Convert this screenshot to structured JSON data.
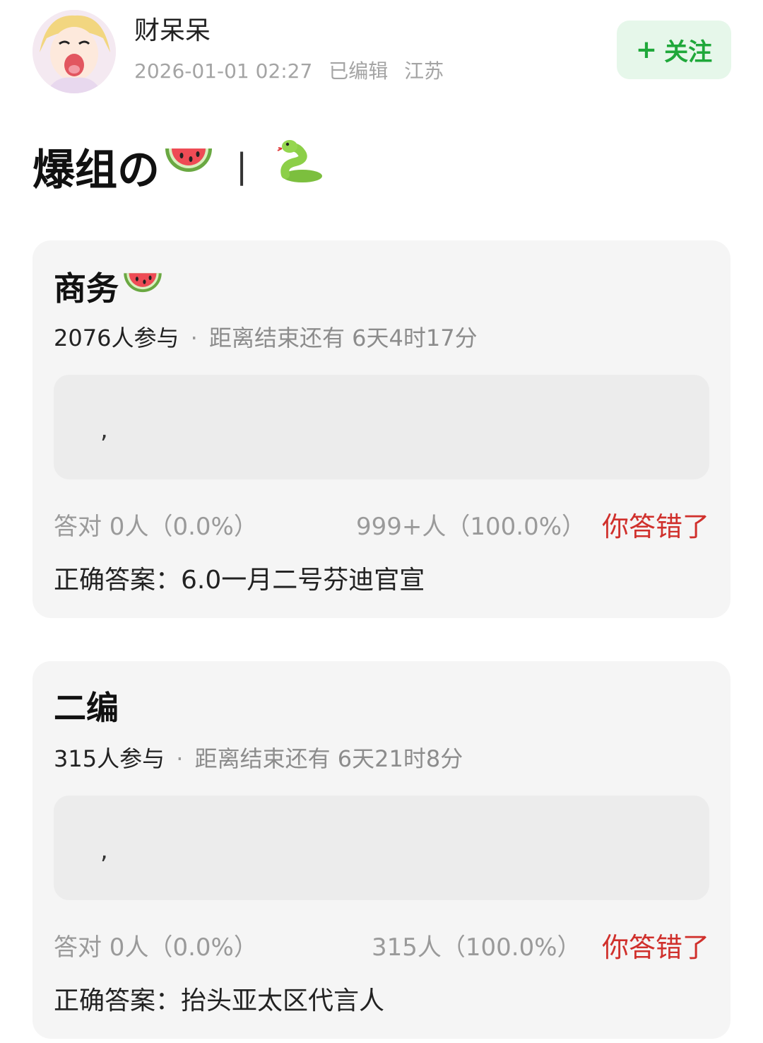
{
  "user": {
    "name": "财呆呆",
    "timestamp": "2026-01-01 02:27",
    "edited": "已编辑",
    "location": "江苏"
  },
  "follow_button": {
    "plus": "+",
    "label": "关注"
  },
  "post": {
    "title": "爆组の",
    "separator": "|"
  },
  "icons": {
    "watermelon": "watermelon-icon",
    "snake": "snake-icon"
  },
  "polls": [
    {
      "title": "商务",
      "participants": "2076人参与",
      "dot": "·",
      "remaining": "距离结束还有 6天4时17分",
      "option_text": ",",
      "correct_label": "答对  0人（0.0%）",
      "others": "999+人（100.0%）",
      "result": "你答错了",
      "answer": "正确答案：6.0一月二号芬迪官宣"
    },
    {
      "title": "二编",
      "participants": "315人参与",
      "dot": "·",
      "remaining": "距离结束还有 6天21时8分",
      "option_text": ",",
      "correct_label": "答对  0人（0.0%）",
      "others": "315人（100.0%）",
      "result": "你答错了",
      "answer": "正确答案：抬头亚太区代言人"
    }
  ],
  "colors": {
    "follow_bg": "#e6f7ea",
    "follow_text": "#1fa83a",
    "card_bg": "#f5f5f5",
    "option_bg": "#ececec",
    "wrong_text": "#d0302c",
    "muted_text": "#a4a4a4"
  }
}
